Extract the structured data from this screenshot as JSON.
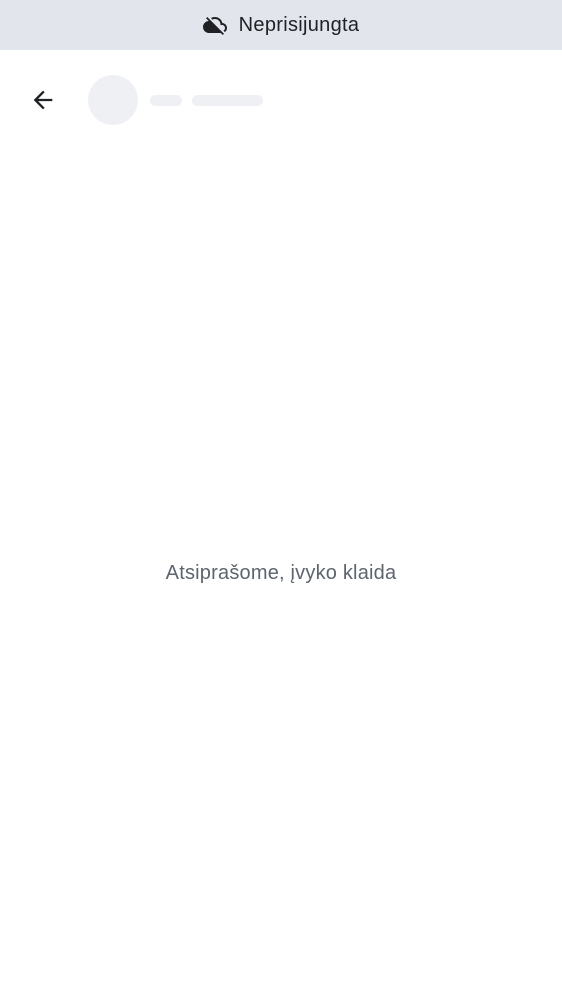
{
  "status_banner": {
    "icon": "cloud-off-icon",
    "text": "Neprisijungta",
    "background": "#e2e5ec"
  },
  "header": {
    "back_icon": "arrow-left-icon",
    "avatar_state": "loading-skeleton",
    "title_state": "loading-skeleton"
  },
  "main": {
    "error_text": "Atsiprašome, įvyko klaida"
  }
}
